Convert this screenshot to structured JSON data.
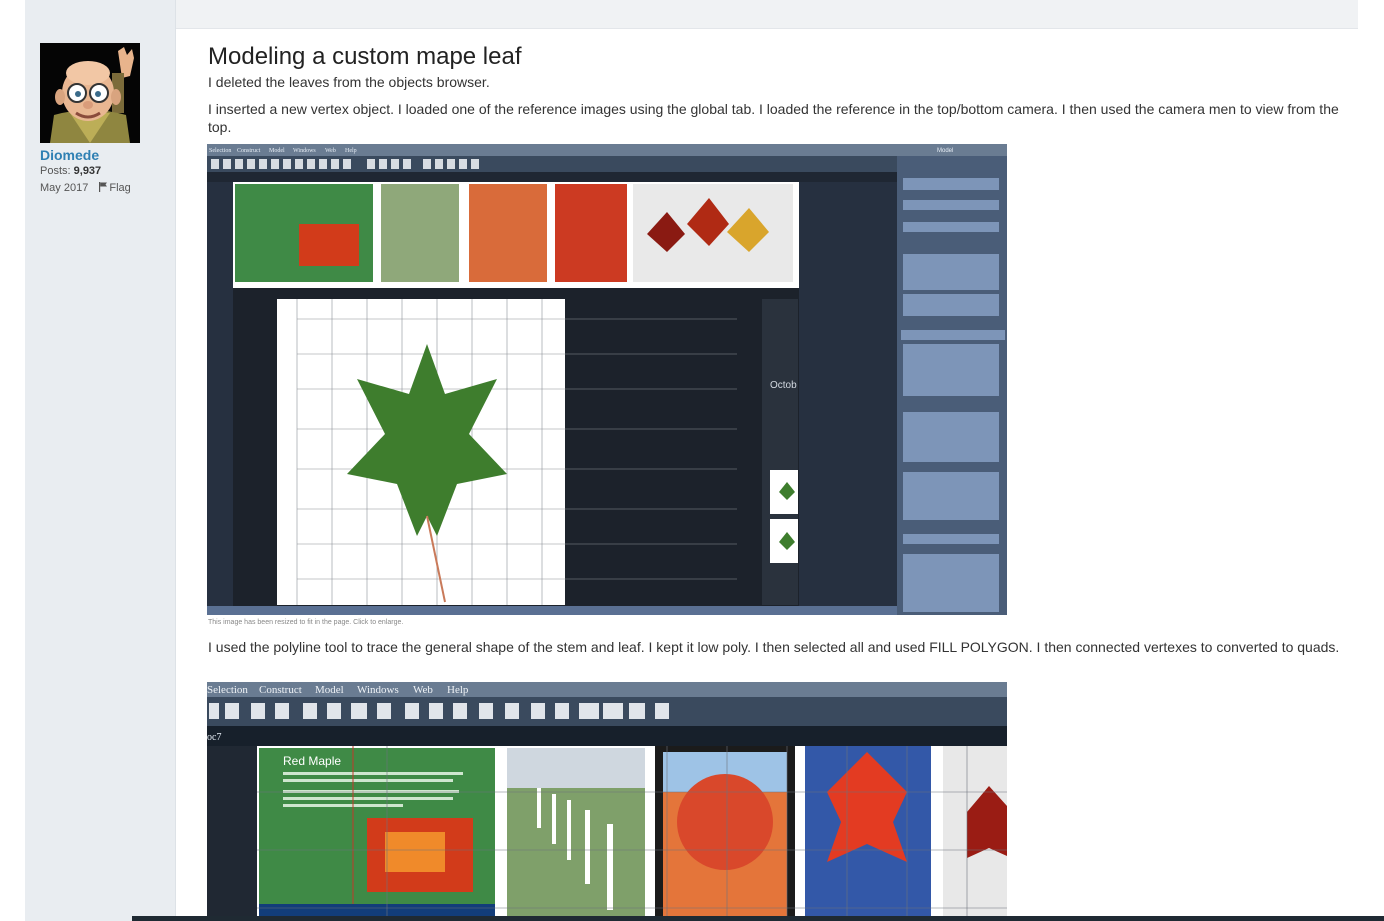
{
  "user": {
    "name": "Diomede",
    "posts_label": "Posts:",
    "posts_count": "9,937",
    "date": "May 2017",
    "flag_label": "Flag"
  },
  "post": {
    "title": "Modeling a custom mape leaf",
    "p1": "I deleted the leaves from the objects browser.",
    "p2": "I inserted a new vertex object.  I loaded one of the reference images using the global tab.  I loaded the reference in the top/bottom camera.  I then used the camera men to view from the top.",
    "caption": "This image has been resized to fit in the page. Click to enlarge.",
    "p3": "I used the polyline tool to trace the general shape of the stem and leaf.  I kept it low poly.  I then selected all and used FILL POLYGON.  I then connected vertexes to converted to quads."
  },
  "screenshot1": {
    "menu": [
      "Selection",
      "Construct",
      "Model",
      "Windows",
      "Web",
      "Help"
    ],
    "right_tab": "Model",
    "side_label": "Octob"
  },
  "screenshot2": {
    "menu": [
      "Selection",
      "Construct",
      "Model",
      "Windows",
      "Web",
      "Help"
    ],
    "doc_label": "oc7",
    "card_title": "Red Maple"
  },
  "colors": {
    "link": "#2f80b3",
    "sidebar_bg": "#e9edf1",
    "app_bg": "#2b3340",
    "leaf_green": "#3e7d2d",
    "maple_red": "#c8321c"
  }
}
